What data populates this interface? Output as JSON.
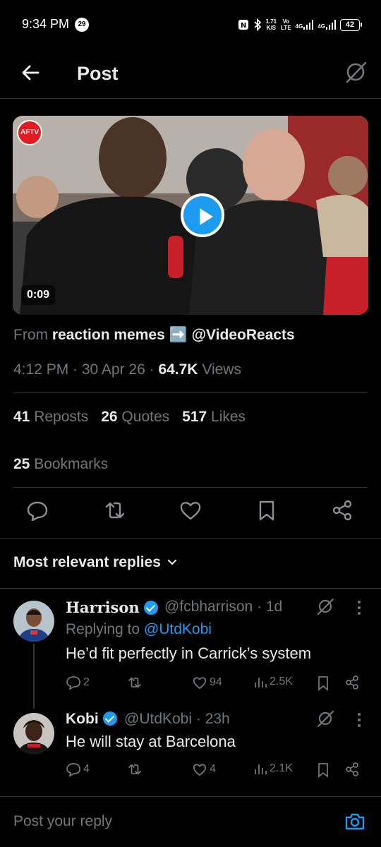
{
  "status_bar": {
    "time": "9:34 PM",
    "badge": "29",
    "net_speed_top": "1.71",
    "net_speed_bottom": "K/S",
    "volte_top": "Vo",
    "volte_bottom": "LTE",
    "sig1": "4G",
    "sig2": "4G",
    "battery": "42"
  },
  "header": {
    "title": "Post"
  },
  "media": {
    "duration": "0:09",
    "logo_text": "AFTV"
  },
  "source": {
    "prefix": "From",
    "name": "reaction memes ➡️ @VideoReacts"
  },
  "meta": {
    "time_date": "4:12 PM · 30 Apr 26 · ",
    "views_count": "64.7K",
    "views_label": " Views"
  },
  "stats": [
    {
      "count": "41",
      "label": " Reposts"
    },
    {
      "count": "26",
      "label": " Quotes"
    },
    {
      "count": "517",
      "label": " Likes"
    }
  ],
  "bookmarks": {
    "count": "25",
    "label": " Bookmarks"
  },
  "replies_filter": {
    "label": "Most relevant replies"
  },
  "replies": [
    {
      "name": "Harrison",
      "handle": "@fcbharrison · 1d",
      "replying_prefix": "Replying to ",
      "replying_to": "@UtdKobi",
      "text": "He’d fit perfectly in Carrick’s system",
      "comments": "2",
      "retweets": "",
      "likes": "94",
      "views": "2.5K"
    },
    {
      "name": "Kobi",
      "handle": "@UtdKobi · 23h",
      "text": "He will stay at Barcelona",
      "comments": "4",
      "retweets": "",
      "likes": "4",
      "views": "2.1K"
    }
  ],
  "compose": {
    "placeholder": "Post your reply"
  },
  "colors": {
    "accent": "#1d9bf0",
    "background": "#000000",
    "muted": "#71767b",
    "text": "#e7e9ea"
  }
}
